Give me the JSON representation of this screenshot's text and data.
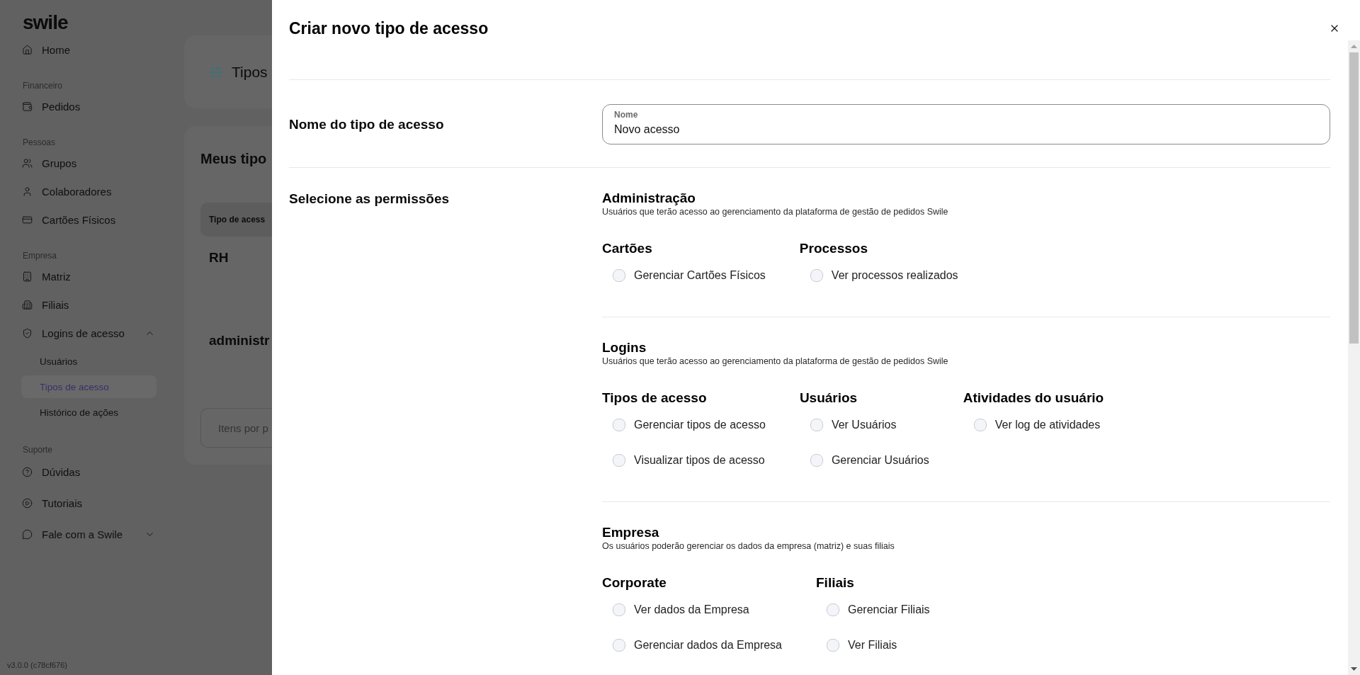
{
  "sidebar": {
    "logo": "swile",
    "sections": [
      {
        "items": [
          {
            "label": "Home",
            "selected": false
          }
        ]
      },
      {
        "title": "Financeiro",
        "items": [
          {
            "label": "Pedidos",
            "selected": false
          }
        ]
      },
      {
        "title": "Pessoas",
        "items": [
          {
            "label": "Grupos",
            "selected": false
          },
          {
            "label": "Colaboradores",
            "selected": false
          },
          {
            "label": "Cartões Físicos",
            "selected": false
          }
        ]
      },
      {
        "title": "Empresa",
        "items": [
          {
            "label": "Matriz",
            "selected": false
          },
          {
            "label": "Filiais",
            "selected": false
          },
          {
            "label": "Logins de acesso",
            "selected": false,
            "expanded": true,
            "children": [
              {
                "label": "Usuários",
                "selected": false
              },
              {
                "label": "Tipos de acesso",
                "selected": true
              },
              {
                "label": "Histórico de ações",
                "selected": false
              }
            ]
          }
        ]
      },
      {
        "title": "Suporte",
        "items": [
          {
            "label": "Dúvidas",
            "selected": false
          },
          {
            "label": "Tutoriais",
            "selected": false
          },
          {
            "label": "Fale com a Swile",
            "selected": false,
            "expanded": false
          }
        ]
      }
    ],
    "version": "v3.0.0 (c78cf676)"
  },
  "page": {
    "header": {
      "title": "Tipos"
    },
    "list": {
      "title": "Meus tipo",
      "table": {
        "columns": [
          "Tipo de acess"
        ],
        "rows": [
          [
            "RH"
          ],
          [
            "administr"
          ]
        ]
      },
      "pagination": {
        "label": "Itens por p"
      }
    }
  },
  "drawer": {
    "title": "Criar novo tipo de acesso",
    "name_row": {
      "label": "Nome do tipo de acesso",
      "field": {
        "label": "Nome",
        "value": "Novo acesso"
      }
    },
    "permissions": {
      "label": "Selecione as permissões",
      "sections": [
        {
          "title": "Administração",
          "description": "Usuários que terão acesso ao gerenciamento da plataforma de gestão de pedidos Swile",
          "groups": [
            {
              "title": "Cartões",
              "options": [
                {
                  "label": "Gerenciar Cartões Físicos",
                  "checked": false
                }
              ]
            },
            {
              "title": "Processos",
              "options": [
                {
                  "label": "Ver processos realizados",
                  "checked": false
                }
              ]
            }
          ]
        },
        {
          "title": "Logins",
          "description": "Usuários que terão acesso ao gerenciamento da plataforma de gestão de pedidos Swile",
          "groups": [
            {
              "title": "Tipos de acesso",
              "options": [
                {
                  "label": "Gerenciar tipos de acesso",
                  "checked": false
                },
                {
                  "label": "Visualizar tipos de acesso",
                  "checked": false
                }
              ]
            },
            {
              "title": "Usuários",
              "options": [
                {
                  "label": "Ver Usuários",
                  "checked": false
                },
                {
                  "label": "Gerenciar Usuários",
                  "checked": false
                }
              ]
            },
            {
              "title": "Atividades do usuário",
              "options": [
                {
                  "label": "Ver log de atividades",
                  "checked": false
                }
              ]
            }
          ]
        },
        {
          "title": "Empresa",
          "description": "Os usuários poderão gerenciar os dados da empresa (matriz) e suas filiais",
          "groups": [
            {
              "title": "Corporate",
              "options": [
                {
                  "label": "Ver dados da Empresa",
                  "checked": false
                },
                {
                  "label": "Gerenciar dados da Empresa",
                  "checked": false
                }
              ]
            },
            {
              "title": "Filiais",
              "options": [
                {
                  "label": "Gerenciar Filiais",
                  "checked": false
                },
                {
                  "label": "Ver Filiais",
                  "checked": false
                }
              ]
            }
          ]
        }
      ]
    }
  }
}
